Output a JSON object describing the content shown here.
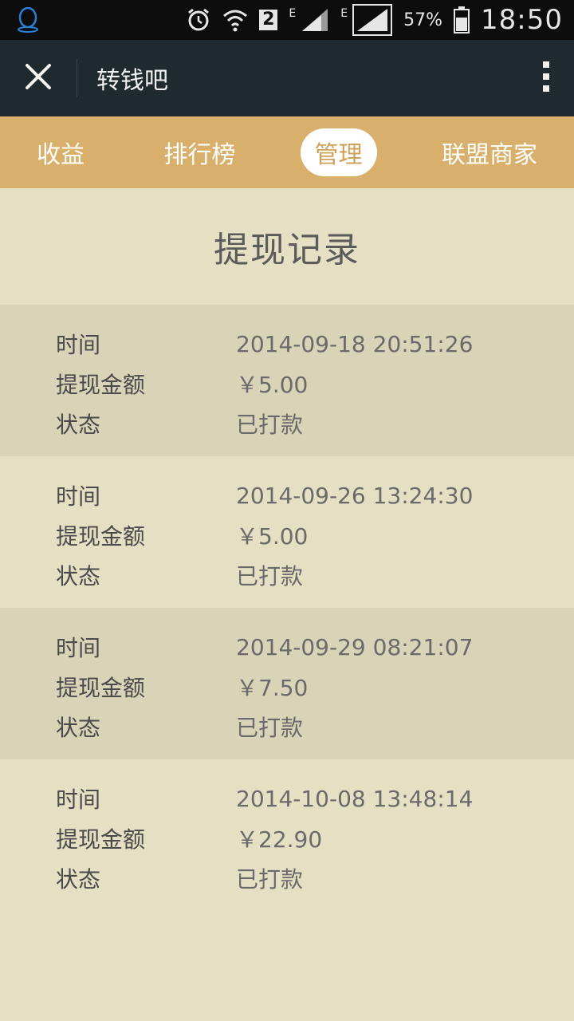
{
  "status_bar": {
    "battery_percent": "57%",
    "time": "18:50",
    "sim_badge": "2",
    "network_1": "E",
    "network_2": "E",
    "icons": [
      "qq-icon",
      "alarm-icon",
      "wifi-icon",
      "signal-icon",
      "battery-icon"
    ]
  },
  "title_bar": {
    "title": "转钱吧",
    "close_icon": "close-icon",
    "more_icon": "more-vertical-icon"
  },
  "tabs": [
    {
      "label": "收益",
      "active": false
    },
    {
      "label": "排行榜",
      "active": false
    },
    {
      "label": "管理",
      "active": true
    },
    {
      "label": "联盟商家",
      "active": false
    }
  ],
  "page": {
    "title": "提现记录"
  },
  "labels": {
    "time": "时间",
    "amount": "提现金额",
    "status": "状态"
  },
  "records": [
    {
      "time": "2014-09-18 20:51:26",
      "amount": "￥5.00",
      "status": "已打款"
    },
    {
      "time": "2014-09-26 13:24:30",
      "amount": "￥5.00",
      "status": "已打款"
    },
    {
      "time": "2014-09-29 08:21:07",
      "amount": "￥7.50",
      "status": "已打款"
    },
    {
      "time": "2014-10-08 13:48:14",
      "amount": "￥22.90",
      "status": "已打款"
    }
  ],
  "colors": {
    "tab_bar": "#d8b06b",
    "title_bar": "#1e2a2e",
    "background": "#e5dfc3",
    "row_shade": "#d9d3b8"
  }
}
